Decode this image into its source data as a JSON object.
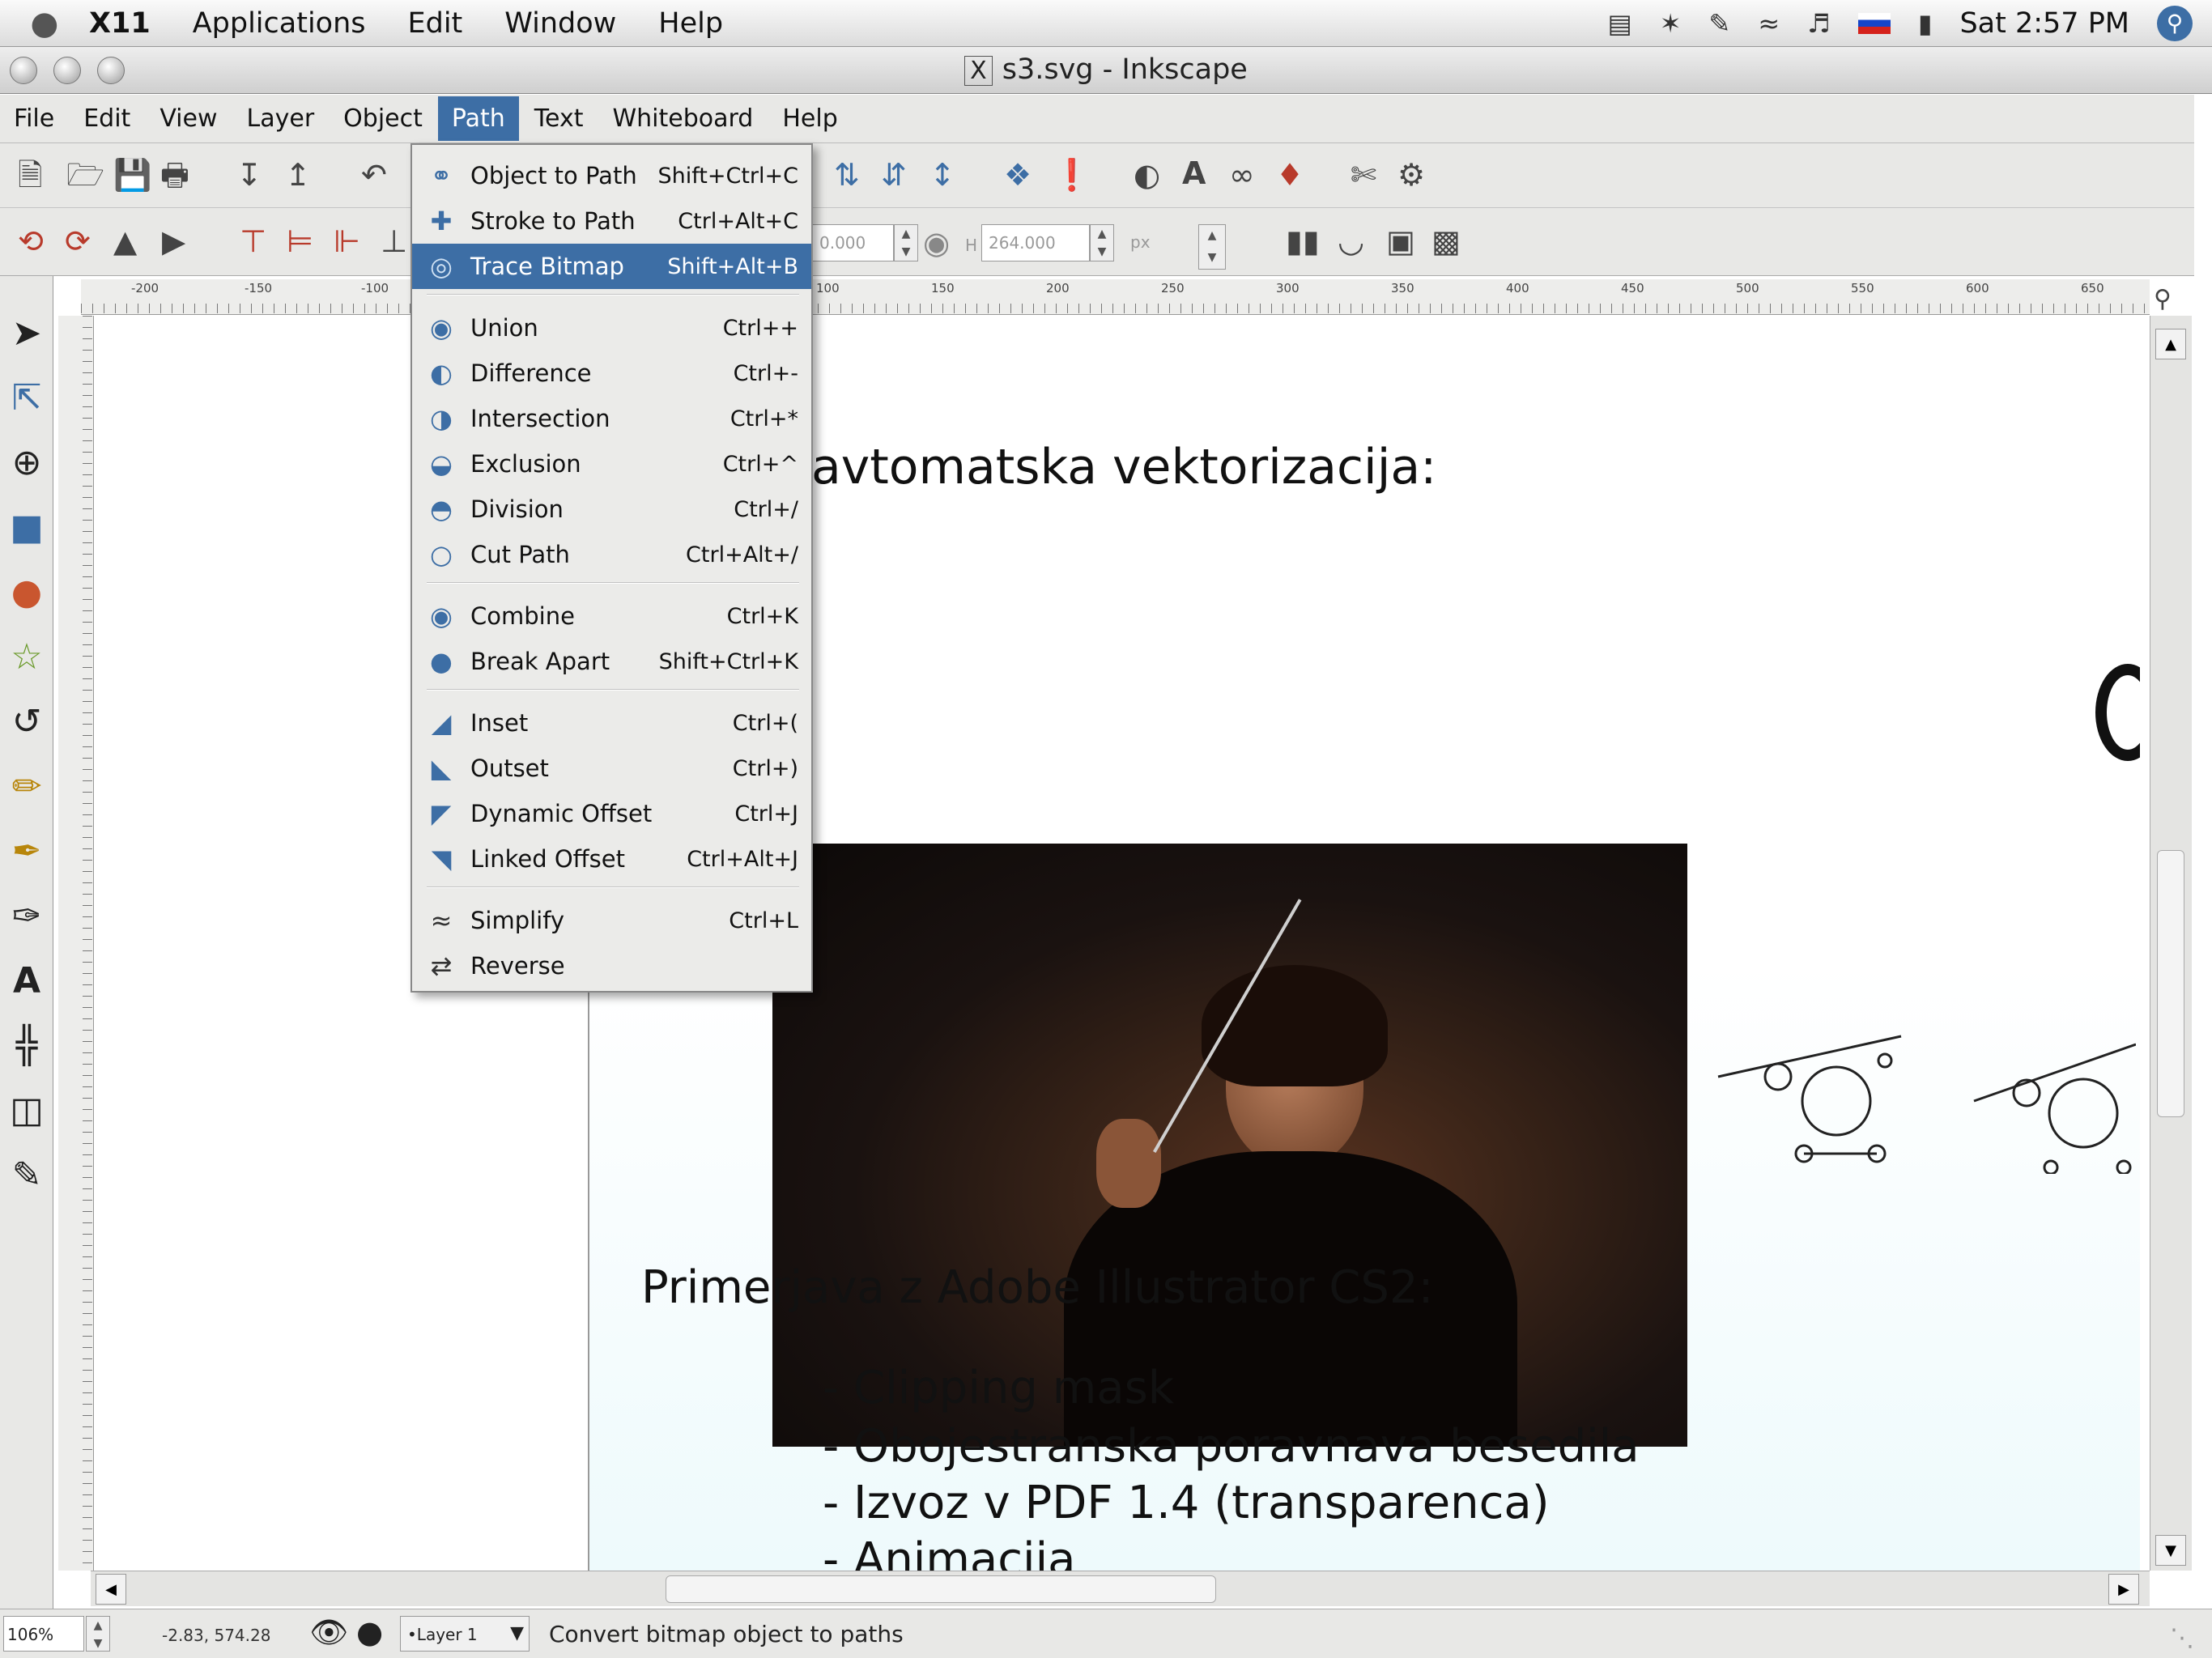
{
  "mac_menubar": {
    "app_name": "X11",
    "items": [
      "Applications",
      "Edit",
      "Window",
      "Help"
    ],
    "clock": "Sat 2:57 PM"
  },
  "window": {
    "title": "s3.svg - Inkscape"
  },
  "menubar": {
    "items": [
      "File",
      "Edit",
      "View",
      "Layer",
      "Object",
      "Path",
      "Text",
      "Whiteboard",
      "Help"
    ],
    "active": "Path"
  },
  "toolbar2": {
    "x_value": "0.000",
    "h_label": "H",
    "h_value": "264.000",
    "unit": "px"
  },
  "path_menu": [
    {
      "label": "Object to Path",
      "shortcut": "Shift+Ctrl+C",
      "icon": "object-to-path-icon"
    },
    {
      "label": "Stroke to Path",
      "shortcut": "Ctrl+Alt+C",
      "icon": "stroke-to-path-icon"
    },
    {
      "label": "Trace Bitmap",
      "shortcut": "Shift+Alt+B",
      "icon": "trace-bitmap-icon",
      "selected": true
    },
    {
      "label": "Union",
      "shortcut": "Ctrl++",
      "icon": "union-icon"
    },
    {
      "label": "Difference",
      "shortcut": "Ctrl+-",
      "icon": "difference-icon"
    },
    {
      "label": "Intersection",
      "shortcut": "Ctrl+*",
      "icon": "intersection-icon"
    },
    {
      "label": "Exclusion",
      "shortcut": "Ctrl+^",
      "icon": "exclusion-icon"
    },
    {
      "label": "Division",
      "shortcut": "Ctrl+/",
      "icon": "division-icon"
    },
    {
      "label": "Cut Path",
      "shortcut": "Ctrl+Alt+/",
      "icon": "cut-path-icon"
    },
    {
      "label": "Combine",
      "shortcut": "Ctrl+K",
      "icon": "combine-icon"
    },
    {
      "label": "Break Apart",
      "shortcut": "Shift+Ctrl+K",
      "icon": "break-apart-icon"
    },
    {
      "label": "Inset",
      "shortcut": "Ctrl+(",
      "icon": "inset-icon"
    },
    {
      "label": "Outset",
      "shortcut": "Ctrl+)",
      "icon": "outset-icon"
    },
    {
      "label": "Dynamic Offset",
      "shortcut": "Ctrl+J",
      "icon": "dynamic-offset-icon"
    },
    {
      "label": "Linked Offset",
      "shortcut": "Ctrl+Alt+J",
      "icon": "linked-offset-icon"
    },
    {
      "label": "Simplify",
      "shortcut": "Ctrl+L",
      "icon": "simplify-icon"
    },
    {
      "label": "Reverse",
      "shortcut": "",
      "icon": "reverse-icon"
    }
  ],
  "document": {
    "heading1": "avtomatska vektorizacija:",
    "heading2": "Primerjava z Adobe Illustrator CS2:",
    "bullets": [
      "- Clipping mask",
      "- Obojestranska poravnava besedila",
      "- Izvoz v PDF 1.4 (transparenca)",
      "- Animacija"
    ]
  },
  "ruler_labels": [
    "-200",
    "-150",
    "-100",
    "100",
    "150",
    "200",
    "250",
    "300",
    "350",
    "400",
    "450",
    "500",
    "550",
    "600",
    "650"
  ],
  "statusbar": {
    "zoom": "106%",
    "coords": "-2.83, 574.28",
    "layer": "•Layer 1",
    "message": "Convert bitmap object to paths"
  },
  "colors": {
    "accent": "#3d6ea5",
    "menu_bg": "#ebebe9"
  }
}
